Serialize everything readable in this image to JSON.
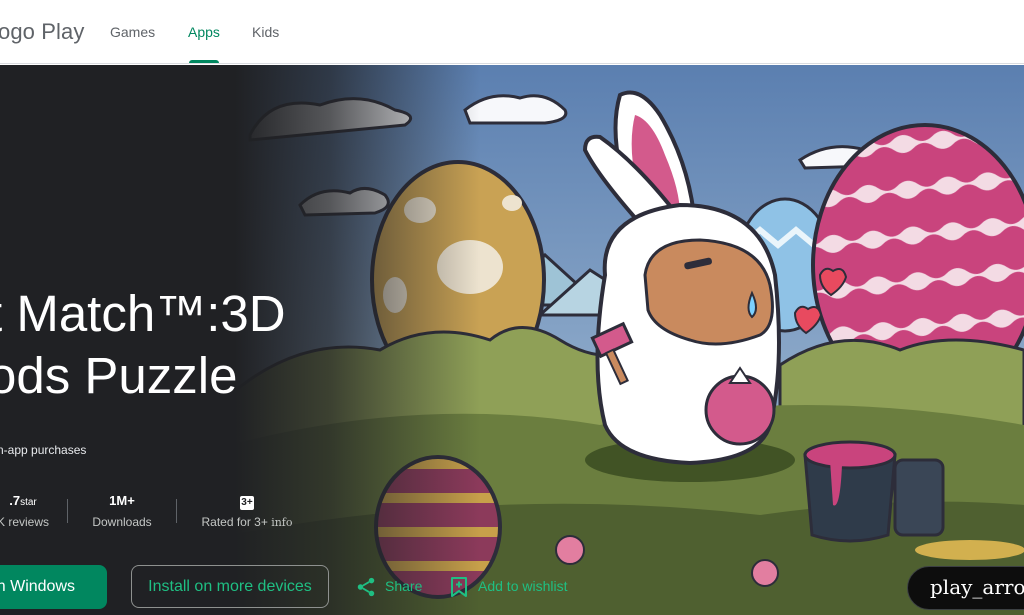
{
  "nav": {
    "brand": "ogo Play",
    "tabs": [
      {
        "label": "Games"
      },
      {
        "label": "Apps"
      },
      {
        "label": "Kids"
      }
    ],
    "active_tab": "Apps"
  },
  "app": {
    "title_line1": "t Match™:3D",
    "title_line2": "ods Puzzle",
    "in_app_purchases": "n-app purchases",
    "stats": {
      "rating": {
        "value": ".7",
        "suffix": "star",
        "label": "K reviews"
      },
      "downloads": {
        "value": "1M+",
        "label": "Downloads"
      },
      "content_rating": {
        "badge": "3+",
        "label": "Rated for 3+",
        "info": "info"
      }
    }
  },
  "actions": {
    "install_windows": "n Windows",
    "install_more": "Install on more devices",
    "share": "Share",
    "wishlist": "Add to wishlist",
    "play_trailer": "play_arrow"
  },
  "icons": [
    "share-icon",
    "bookmark-add-icon"
  ],
  "colors": {
    "accent": "#01875f",
    "accent_light": "#1fbf83",
    "hero_bg": "#202124"
  }
}
